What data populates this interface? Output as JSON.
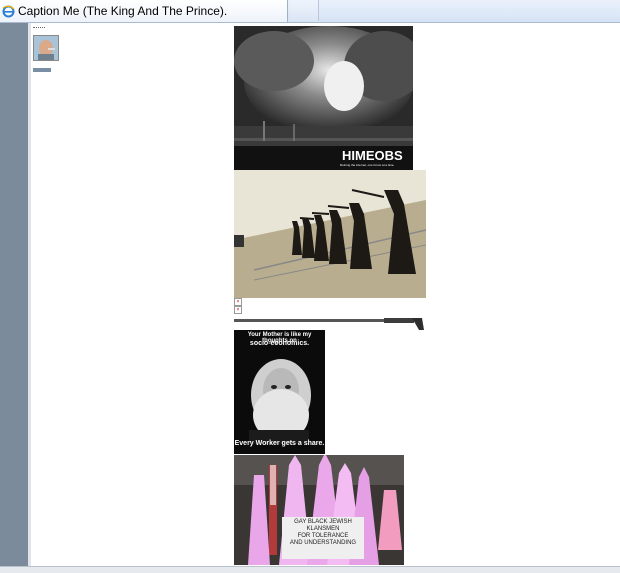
{
  "tab": {
    "title": "Caption Me (The King And The Prince).",
    "icon": "ie-browser-icon"
  },
  "images": [
    {
      "name": "pearl-harbor-motivational",
      "caption_title": "HIMEOBS",
      "caption_sub": "Ruining the internet, one forum at a time."
    },
    {
      "name": "nuns-shooting-range"
    },
    {
      "name": "rifle-image"
    },
    {
      "name": "marx-meme",
      "top_text_1": "Your Mother is like my thoughts on",
      "top_text_2": "socio-economics.",
      "bottom_text": "Every Worker gets a share."
    },
    {
      "name": "pink-robes-meme",
      "sign_lines": [
        "GAY BLACK JEWISH",
        "KLANSMEN",
        "FOR TOLERANCE",
        "AND UNDERSTANDING"
      ]
    }
  ]
}
